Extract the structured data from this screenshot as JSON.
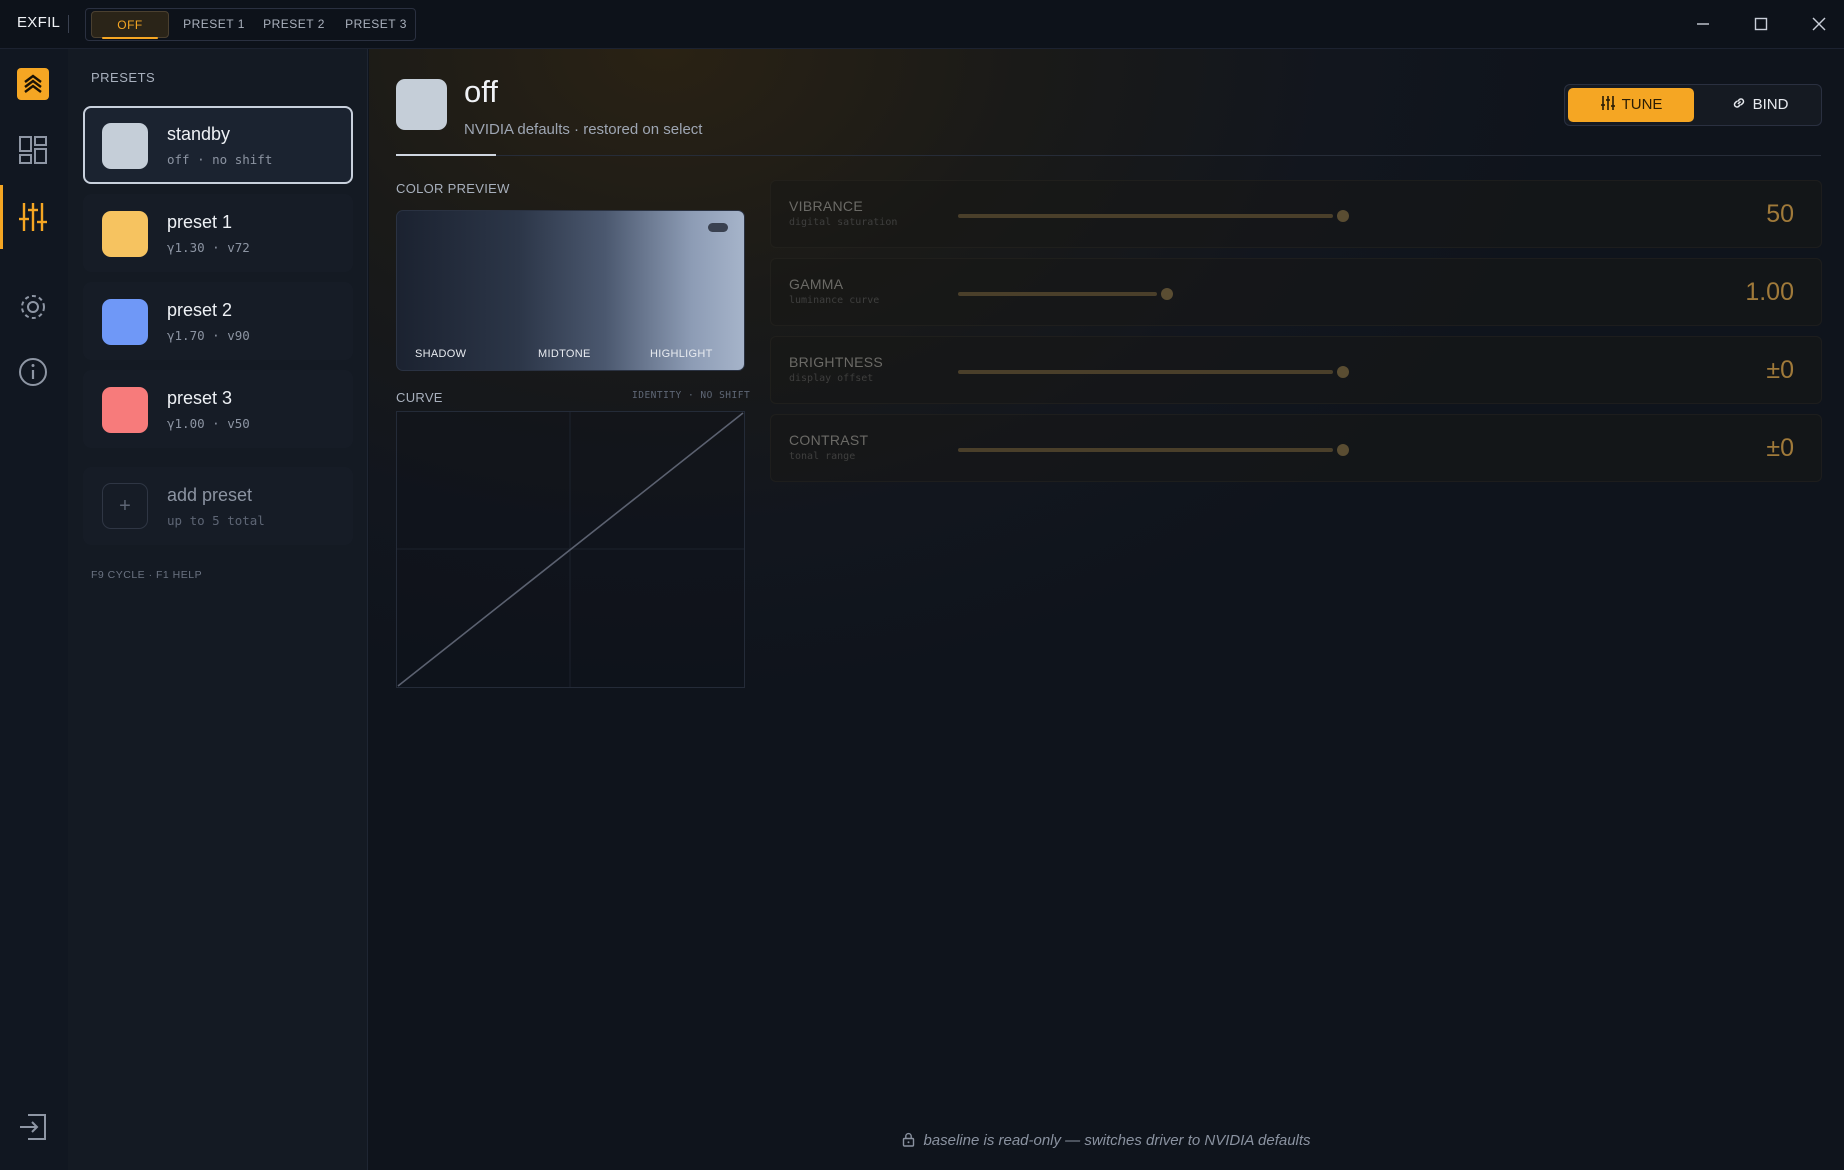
{
  "app": {
    "name": "EXFIL"
  },
  "tabs": [
    {
      "label": "OFF",
      "active": true
    },
    {
      "label": "PRESET 1",
      "active": false
    },
    {
      "label": "PRESET 2",
      "active": false
    },
    {
      "label": "PRESET 3",
      "active": false
    }
  ],
  "window_controls": [
    "minimize-icon",
    "maximize-icon",
    "close-icon"
  ],
  "rail": {
    "items": [
      "logo-icon",
      "dashboard-icon",
      "sliders-icon",
      "settings-icon",
      "info-icon"
    ],
    "active": "sliders-icon",
    "bottom": "exit-icon"
  },
  "presets": {
    "heading": "PRESETS",
    "items": [
      {
        "name": "standby",
        "sub": "off · no shift",
        "color": "#c5ced8",
        "selected": true
      },
      {
        "name": "preset 1",
        "sub": "γ1.30 · v72",
        "color": "#f6c360",
        "selected": false
      },
      {
        "name": "preset 2",
        "sub": "γ1.70 · v90",
        "color": "#6f98f7",
        "selected": false
      },
      {
        "name": "preset 3",
        "sub": "γ1.00 · v50",
        "color": "#f77b7b",
        "selected": false
      }
    ],
    "add": {
      "name": "add preset",
      "sub": "up to 5 total",
      "icon": "+"
    },
    "shortcuts": "F9 CYCLE · F1 HELP"
  },
  "header": {
    "title": "off",
    "subtitle": "NVIDIA defaults · restored on select",
    "swatch_color": "#c5ced8"
  },
  "mode_toggle": {
    "tune_label": "TUNE",
    "bind_label": "BIND",
    "active": "TUNE"
  },
  "color_preview": {
    "label": "COLOR PREVIEW",
    "stops": [
      "SHADOW",
      "MIDTONE",
      "HIGHLIGHT"
    ]
  },
  "curve": {
    "label": "CURVE",
    "tag": "IDENTITY · NO SHIFT"
  },
  "sliders": [
    {
      "name": "VIBRANCE",
      "desc": "digital saturation",
      "value": "50",
      "level": 1.0
    },
    {
      "name": "GAMMA",
      "desc": "luminance curve",
      "value": "1.00",
      "level": 0.53
    },
    {
      "name": "BRIGHTNESS",
      "desc": "display offset",
      "value": "±0",
      "level": 1.0
    },
    {
      "name": "CONTRAST",
      "desc": "tonal range",
      "value": "±0",
      "level": 1.0
    }
  ],
  "footer": {
    "note": "baseline is read-only — switches driver to NVIDIA defaults"
  },
  "colors": {
    "accent": "#f5a623",
    "background": "#0f141c"
  }
}
